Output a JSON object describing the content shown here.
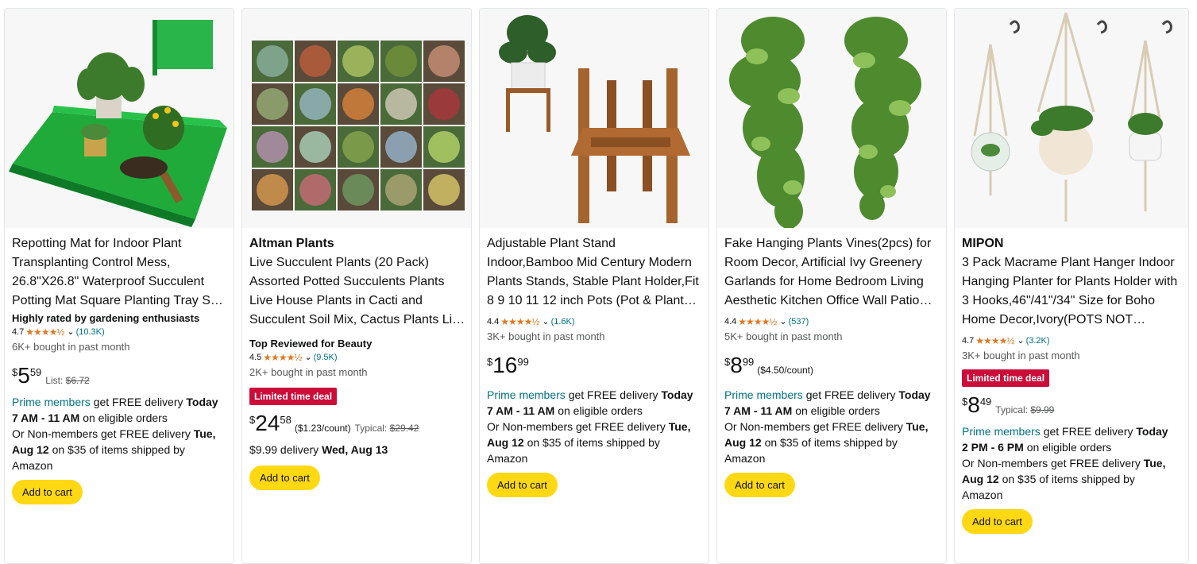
{
  "cards": [
    {
      "brand": "",
      "title": "Repotting Mat for Indoor Plant Transplanting Control Mess, 26.8\"X26.8\" Waterproof Succulent Potting Mat Square Planting Tray S…",
      "badge": "Highly rated by gardening enthusiasts",
      "rating": "4.7",
      "stars": "★★★★½",
      "review_count": "(10.3K)",
      "bought": "6K+ bought in past month",
      "deal": "",
      "price_symbol": "$",
      "price_whole": "5",
      "price_fraction": "59",
      "price_note_label": "List:",
      "price_note_value": "$6.72",
      "unit_price": "",
      "delivery_prime": "Prime members",
      "delivery_text1": "get FREE delivery",
      "delivery_day": "Today",
      "delivery_window": "7 AM - 11 AM",
      "delivery_text2": "on eligible orders",
      "delivery_non": "Or Non-members get FREE delivery",
      "delivery_date": "Tue, Aug 12",
      "delivery_text3": "on $35 of items shipped by Amazon",
      "cart_label": "Add to cart",
      "image_icon": "repotting-mat-image"
    },
    {
      "brand": "Altman Plants",
      "title": "Live Succulent Plants (20 Pack) Assorted Potted Succulents Plants Live House Plants in Cacti and Succulent Soil Mix, Cactus Plants Li…",
      "badge": "Top Reviewed for Beauty",
      "rating": "4.5",
      "stars": "★★★★½",
      "review_count": "(9.5K)",
      "bought": "2K+ bought in past month",
      "deal": "Limited time deal",
      "price_symbol": "$",
      "price_whole": "24",
      "price_fraction": "58",
      "unit_price": "($1.23/count)",
      "price_note_label": "Typical:",
      "price_note_value": "$29.42",
      "simple_delivery_prefix": "$9.99 delivery",
      "simple_delivery_date": "Wed, Aug 13",
      "cart_label": "Add to cart",
      "image_icon": "succulents-image"
    },
    {
      "brand": "",
      "title": "Adjustable Plant Stand Indoor,Bamboo Mid Century Modern Plants Stands, Stable Plant Holder,Fit 8 9 10 11 12 inch Pots (Pot & Plant…",
      "badge": "",
      "rating": "4.4",
      "stars": "★★★★½",
      "review_count": "(1.6K)",
      "bought": "3K+ bought in past month",
      "deal": "",
      "price_symbol": "$",
      "price_whole": "16",
      "price_fraction": "99",
      "delivery_prime": "Prime members",
      "delivery_text1": "get FREE delivery",
      "delivery_day": "Today",
      "delivery_window": "7 AM - 11 AM",
      "delivery_text2": "on eligible orders",
      "delivery_non": "Or Non-members get FREE delivery",
      "delivery_date": "Tue, Aug 12",
      "delivery_text3": "on $35 of items shipped by Amazon",
      "cart_label": "Add to cart",
      "image_icon": "plant-stand-image"
    },
    {
      "brand": "",
      "title": "Fake Hanging Plants Vines(2pcs) for Room Decor, Artificial Ivy Greenery Garlands for Home Bedroom Living Aesthetic Kitchen Office Wall Patio…",
      "badge": "",
      "rating": "4.4",
      "stars": "★★★★½",
      "review_count": "(537)",
      "bought": "5K+ bought in past month",
      "deal": "",
      "price_symbol": "$",
      "price_whole": "8",
      "price_fraction": "99",
      "unit_price": "($4.50/count)",
      "delivery_prime": "Prime members",
      "delivery_text1": "get FREE delivery",
      "delivery_day": "Today",
      "delivery_window": "7 AM - 11 AM",
      "delivery_text2": "on eligible orders",
      "delivery_non": "Or Non-members get FREE delivery",
      "delivery_date": "Tue, Aug 12",
      "delivery_text3": "on $35 of items shipped by Amazon",
      "cart_label": "Add to cart",
      "image_icon": "hanging-vines-image"
    },
    {
      "brand": "MIPON",
      "title": "3 Pack Macrame Plant Hanger Indoor Hanging Planter for Plants Holder with 3 Hooks,46\"/41\"/34\" Size for Boho Home Decor,Ivory(POTS NOT…",
      "badge": "",
      "rating": "4.7",
      "stars": "★★★★½",
      "review_count": "(3.2K)",
      "bought": "3K+ bought in past month",
      "deal": "Limited time deal",
      "price_symbol": "$",
      "price_whole": "8",
      "price_fraction": "49",
      "price_note_label": "Typical:",
      "price_note_value": "$9.99",
      "delivery_prime": "Prime members",
      "delivery_text1": "get FREE delivery",
      "delivery_day": "Today",
      "delivery_window": "2 PM - 6 PM",
      "delivery_text2": "on eligible orders",
      "delivery_non": "Or Non-members get FREE delivery",
      "delivery_date": "Tue, Aug 12",
      "delivery_text3": "on $35 of items shipped by Amazon",
      "cart_label": "Add to cart",
      "image_icon": "macrame-hanger-image"
    }
  ]
}
